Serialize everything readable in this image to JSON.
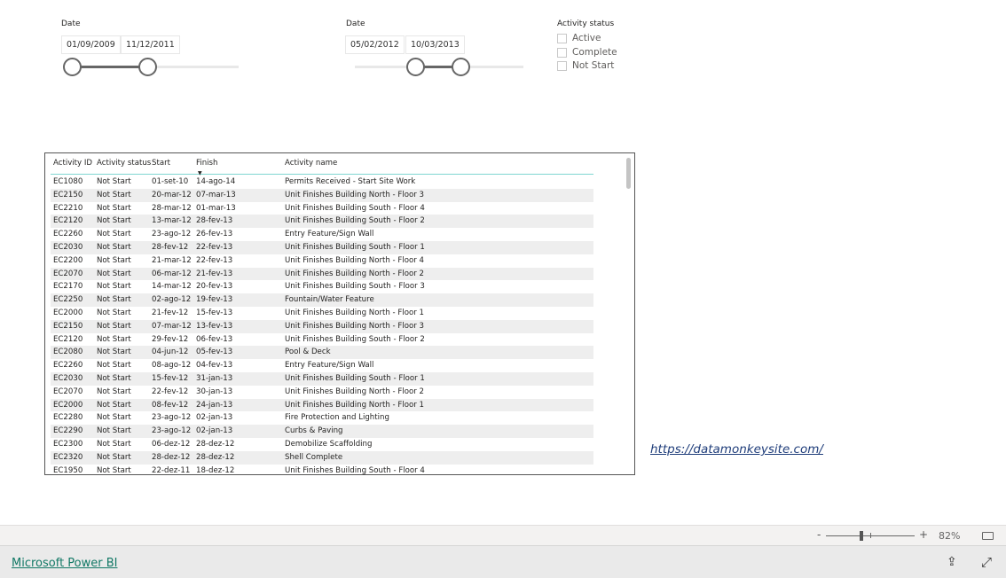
{
  "slicer1": {
    "title": "Date",
    "from": "01/09/2009",
    "to": "11/12/2011"
  },
  "slicer2": {
    "title": "Date",
    "from": "05/02/2012",
    "to": "10/03/2013"
  },
  "status_slicer": {
    "title": "Activity status",
    "options": [
      {
        "label": "Active",
        "checked": false
      },
      {
        "label": "Complete",
        "checked": false
      },
      {
        "label": "Not Start",
        "checked": false
      }
    ]
  },
  "table": {
    "columns": [
      "Activity ID",
      "Activity status",
      "Start",
      "Finish",
      "Activity name"
    ],
    "sorted_column": "Finish",
    "rows": [
      [
        "EC1080",
        "Not Start",
        "01-set-10",
        "14-ago-14",
        "Permits Received - Start Site Work"
      ],
      [
        "EC2150",
        "Not Start",
        "20-mar-12",
        "07-mar-13",
        "Unit Finishes Building North - Floor 3"
      ],
      [
        "EC2210",
        "Not Start",
        "28-mar-12",
        "01-mar-13",
        "Unit Finishes Building South - Floor 4"
      ],
      [
        "EC2120",
        "Not Start",
        "13-mar-12",
        "28-fev-13",
        "Unit Finishes Building South - Floor 2"
      ],
      [
        "EC2260",
        "Not Start",
        "23-ago-12",
        "26-fev-13",
        "Entry Feature/Sign Wall"
      ],
      [
        "EC2030",
        "Not Start",
        "28-fev-12",
        "22-fev-13",
        "Unit Finishes Building South - Floor 1"
      ],
      [
        "EC2200",
        "Not Start",
        "21-mar-12",
        "22-fev-13",
        "Unit Finishes Building North - Floor 4"
      ],
      [
        "EC2070",
        "Not Start",
        "06-mar-12",
        "21-fev-13",
        "Unit Finishes Building North - Floor 2"
      ],
      [
        "EC2170",
        "Not Start",
        "14-mar-12",
        "20-fev-13",
        "Unit Finishes Building South - Floor 3"
      ],
      [
        "EC2250",
        "Not Start",
        "02-ago-12",
        "19-fev-13",
        "Fountain/Water Feature"
      ],
      [
        "EC2000",
        "Not Start",
        "21-fev-12",
        "15-fev-13",
        "Unit Finishes Building North - Floor 1"
      ],
      [
        "EC2150",
        "Not Start",
        "07-mar-12",
        "13-fev-13",
        "Unit Finishes Building North - Floor 3"
      ],
      [
        "EC2120",
        "Not Start",
        "29-fev-12",
        "06-fev-13",
        "Unit Finishes Building South - Floor 2"
      ],
      [
        "EC2080",
        "Not Start",
        "04-jun-12",
        "05-fev-13",
        "Pool & Deck"
      ],
      [
        "EC2260",
        "Not Start",
        "08-ago-12",
        "04-fev-13",
        "Entry Feature/Sign Wall"
      ],
      [
        "EC2030",
        "Not Start",
        "15-fev-12",
        "31-jan-13",
        "Unit Finishes Building South - Floor 1"
      ],
      [
        "EC2070",
        "Not Start",
        "22-fev-12",
        "30-jan-13",
        "Unit Finishes Building North - Floor 2"
      ],
      [
        "EC2000",
        "Not Start",
        "08-fev-12",
        "24-jan-13",
        "Unit Finishes Building North - Floor 1"
      ],
      [
        "EC2280",
        "Not Start",
        "23-ago-12",
        "02-jan-13",
        "Fire Protection and Lighting"
      ],
      [
        "EC2290",
        "Not Start",
        "23-ago-12",
        "02-jan-13",
        "Curbs & Paving"
      ],
      [
        "EC2300",
        "Not Start",
        "06-dez-12",
        "28-dez-12",
        "Demobilize Scaffolding"
      ],
      [
        "EC2320",
        "Not Start",
        "28-dez-12",
        "28-dez-12",
        "Shell Complete"
      ],
      [
        "EC1950",
        "Not Start",
        "22-dez-11",
        "18-dez-12",
        "Unit Finishes Building South - Floor 4"
      ]
    ]
  },
  "link": "https://datamonkeysite.com/",
  "zoom": {
    "minus": "-",
    "plus": "+",
    "level": "82%"
  },
  "footer": {
    "brand": "Microsoft Power BI"
  },
  "icons": {
    "fit": "fit-page-icon",
    "share": "share-icon",
    "fullscreen": "expand-icon"
  }
}
